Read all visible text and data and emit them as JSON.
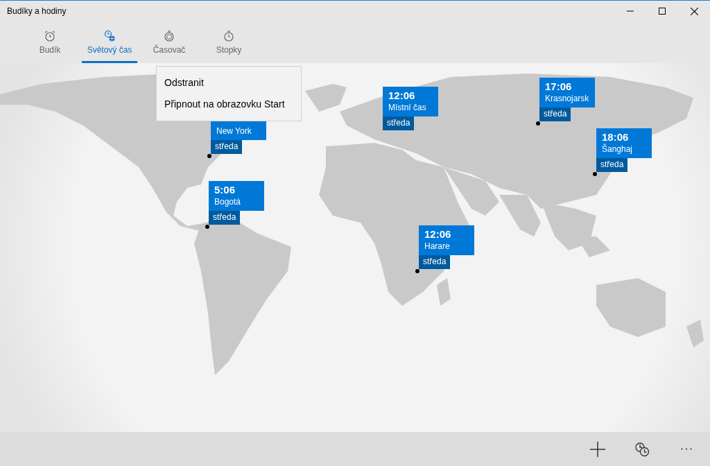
{
  "window": {
    "title": "Budíky a hodiny"
  },
  "tabs": [
    {
      "label": "Budík",
      "kind": "alarm",
      "selected": false
    },
    {
      "label": "Světový čas",
      "kind": "world",
      "selected": true
    },
    {
      "label": "Časovač",
      "kind": "timer",
      "selected": false
    },
    {
      "label": "Stopky",
      "kind": "stopwatch",
      "selected": false
    }
  ],
  "clocks": [
    {
      "kind": "city",
      "city": "New York",
      "day": "středa"
    },
    {
      "kind": "city",
      "time": "5:06",
      "city": "Bogotá",
      "day": "středa"
    },
    {
      "kind": "local",
      "time": "12:06",
      "city": "Místní čas",
      "day": "středa"
    },
    {
      "kind": "city",
      "time": "17:06",
      "city": "Krasnojarsk",
      "day": "středa"
    },
    {
      "kind": "city",
      "time": "18:06",
      "city": "Šanghaj",
      "day": "středa"
    },
    {
      "kind": "city",
      "time": "12:06",
      "city": "Harare",
      "day": "středa"
    }
  ],
  "context_menu": {
    "items": [
      "Odstranit",
      "Připnout na obrazovku Start"
    ]
  }
}
